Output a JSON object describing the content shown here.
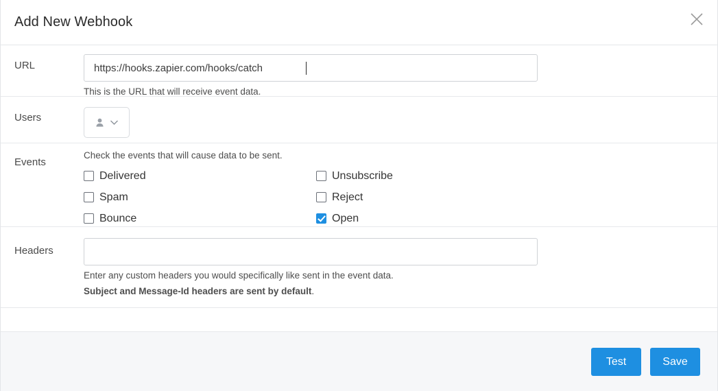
{
  "dialog": {
    "title": "Add New Webhook",
    "close_icon": "close-icon"
  },
  "form": {
    "url": {
      "label": "URL",
      "value": "https://hooks.zapier.com/hooks/catch",
      "placeholder": "",
      "help": "This is the URL that will receive event data."
    },
    "users": {
      "label": "Users",
      "icon": "user-icon",
      "chevron": "chevron-down-icon",
      "selected": ""
    },
    "events": {
      "label": "Events",
      "hint": "Check the events that will cause data to be sent.",
      "options": [
        {
          "label": "Delivered",
          "checked": false
        },
        {
          "label": "Unsubscribe",
          "checked": false
        },
        {
          "label": "Spam",
          "checked": false
        },
        {
          "label": "Reject",
          "checked": false
        },
        {
          "label": "Bounce",
          "checked": false
        },
        {
          "label": "Open",
          "checked": true
        }
      ]
    },
    "headers": {
      "label": "Headers",
      "value": "",
      "placeholder": "",
      "help": "Enter any custom headers you would specifically like sent in the event data.",
      "help_bold": "Subject and Message-Id headers are sent by default",
      "help_bold_period": "."
    }
  },
  "footer": {
    "test_label": "Test",
    "save_label": "Save"
  },
  "colors": {
    "accent": "#1e8fe1",
    "footer_bg": "#f6f7f9",
    "border": "#e7e8eb",
    "text": "#343434"
  }
}
